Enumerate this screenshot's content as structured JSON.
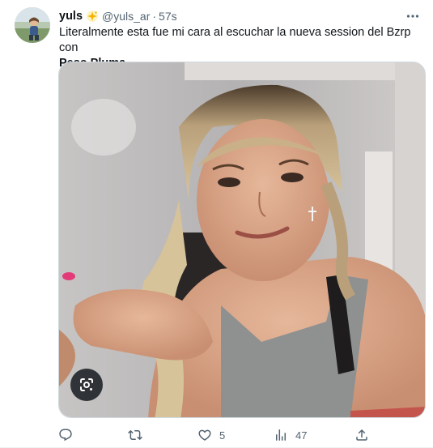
{
  "tweet": {
    "display_name": "yuls",
    "badge_icon": "sparkle-badge-icon",
    "handle": "@yuls_ar",
    "separator": "·",
    "time": "57s",
    "text_prefix": "Literalmente esta fue mi cara al escuchar la nueva session del Bzrp con",
    "text_bold": "Peso Pluma"
  },
  "media": {
    "type": "photo",
    "lens_icon": "google-lens-icon"
  },
  "actions": {
    "reply": {
      "icon": "reply-icon",
      "count": ""
    },
    "retweet": {
      "icon": "retweet-icon",
      "count": ""
    },
    "like": {
      "icon": "heart-icon",
      "count": "5"
    },
    "views": {
      "icon": "views-chart-icon",
      "count": "47"
    },
    "share": {
      "icon": "share-icon",
      "count": ""
    }
  },
  "colors": {
    "text": "#0f1419",
    "muted": "#536471",
    "border": "#cfd9de"
  }
}
